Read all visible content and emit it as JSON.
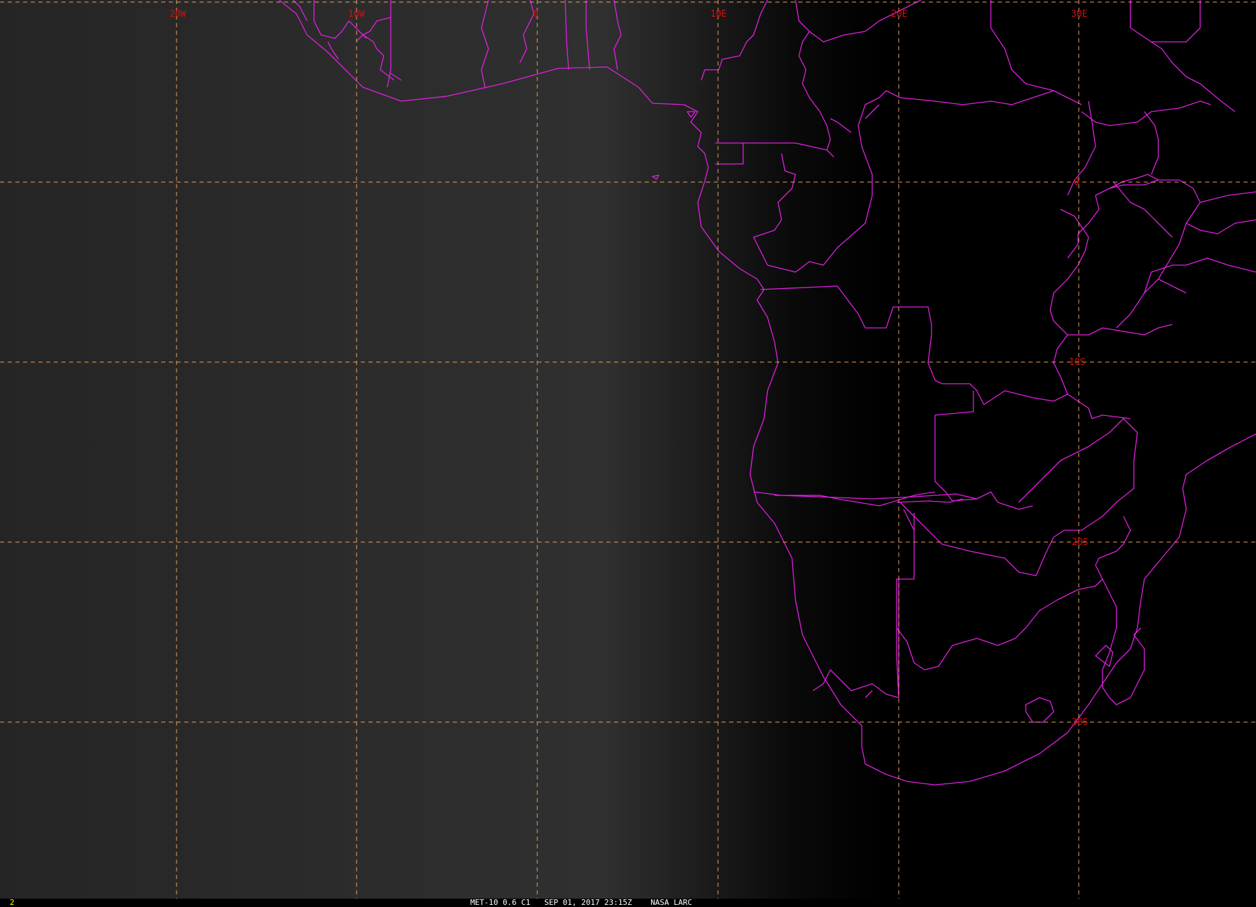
{
  "map": {
    "longitude_labels": [
      "20W",
      "10W",
      "0",
      "10E",
      "20E",
      "30E"
    ],
    "latitude_labels": [
      "0",
      "10S",
      "20S",
      "30S"
    ],
    "colors": {
      "ocean_day": "#2d2d2d",
      "night": "#000000",
      "coastline": "#e020e0",
      "gridline": "#e8a060",
      "grid_label": "#d01010",
      "frame_number": "#ffff00",
      "caption_text": "#ffffff"
    }
  },
  "status_bar": {
    "frame_number": "2",
    "satellite_channel": "MET-10 0.6 C1",
    "date_time": "SEP 01, 2017 23:15Z",
    "source": "NASA LARC"
  }
}
